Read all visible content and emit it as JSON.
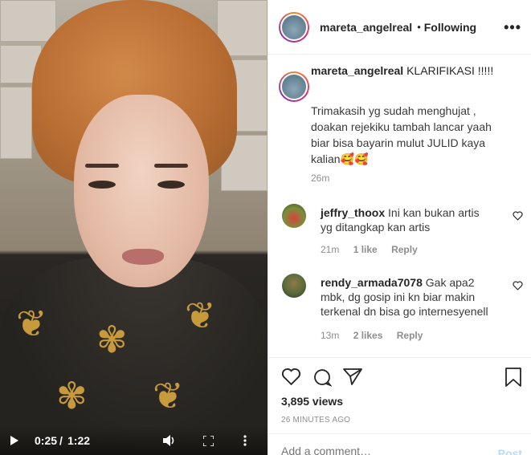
{
  "video": {
    "current_time": "0:25",
    "separator": "/",
    "duration": "1:22"
  },
  "post": {
    "author": "mareta_angelreal",
    "dot": "•",
    "follow_status": "Following",
    "more_icon": "more-icon"
  },
  "caption": {
    "author": "mareta_angelreal",
    "title": "KLARIFIKASI !!!!!",
    "body": "Trimakasih yg sudah menghujat , doakan rejekiku tambah lancar yaah biar bisa bayarin mulut JULID kaya kalian🥰🥰",
    "time": "26m"
  },
  "comments": [
    {
      "author": "jeffry_thoox",
      "text": "Ini kan bukan artis yg ditangkap kan artis",
      "time": "21m",
      "likes": "1 like",
      "reply": "Reply"
    },
    {
      "author": "rendy_armada7078",
      "text": "Gak apa2 mbk, dg gosip ini kn biar makin terkenal dn bisa go internesyenell",
      "time": "13m",
      "likes": "2 likes",
      "reply": "Reply"
    }
  ],
  "stats": {
    "views": "3,895 views",
    "posted_ago": "26 MINUTES AGO"
  },
  "add_comment": {
    "placeholder": "Add a comment…",
    "post_label": "Post"
  },
  "colors": {
    "link_blue": "#b3dbff",
    "muted": "#8e8e8e"
  }
}
